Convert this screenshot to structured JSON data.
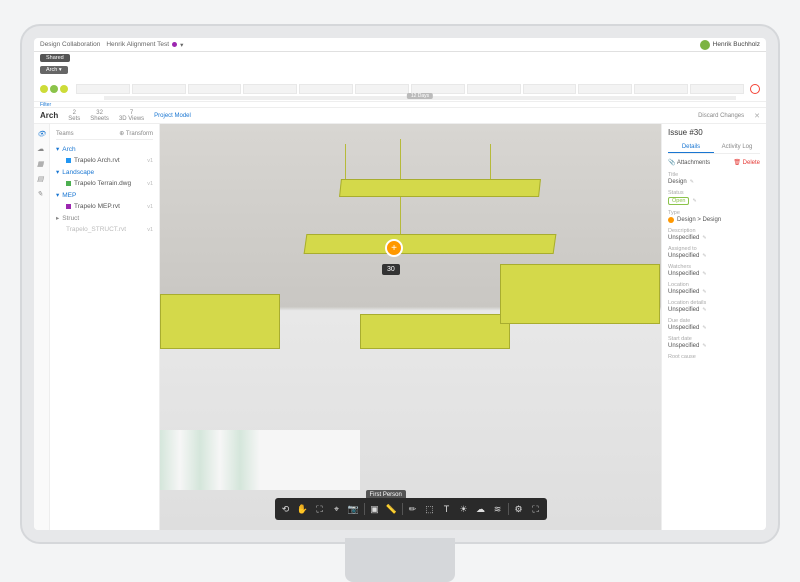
{
  "tabs": {
    "t1": "Design Collaboration",
    "t2": "Henrik Alignment Test",
    "user": "Henrik Buchholz"
  },
  "filters": {
    "shared": "Shared",
    "arch": "Arch",
    "filter": "Filter"
  },
  "timeline": {
    "label": "12 Days"
  },
  "meta": {
    "title": "Arch",
    "sets": "2",
    "sets_l": "Sets",
    "sheets": "32",
    "sheets_l": "Sheets",
    "views": "7",
    "views_l": "3D Views",
    "pm": "Project Model",
    "discard": "Discard Changes"
  },
  "tree": {
    "hdr1": "Teams",
    "hdr2": "Transform",
    "g1": "Arch",
    "i1": "Trapelo Arch.rvt",
    "g2": "Landscape",
    "i2": "Trapelo Terrain.dwg",
    "g3": "MEP",
    "i3": "Trapelo MEP.rvt",
    "g4": "Struct",
    "i4": "Trapelo_STRUCT.rvt"
  },
  "view": {
    "marker": "+",
    "tooltip": "30",
    "toolbar_tip": "First Person"
  },
  "panel": {
    "title": "Issue #30",
    "tab1": "Details",
    "tab2": "Activity Log",
    "attach": "Attachments",
    "delete": "Delete",
    "f_title": "Title",
    "v_title": "Design",
    "f_status": "Status",
    "v_status": "Open",
    "f_type": "Type",
    "v_type": "Design > Design",
    "f_desc": "Description",
    "v_desc": "Unspecified",
    "f_assign": "Assigned to",
    "v_assign": "Unspecified",
    "f_watch": "Watchers",
    "v_watch": "Unspecified",
    "f_loc": "Location",
    "v_loc": "Unspecified",
    "f_locd": "Location details",
    "v_locd": "Unspecified",
    "f_due": "Due date",
    "v_due": "Unspecified",
    "f_start": "Start date",
    "v_start": "Unspecified",
    "f_root": "Root cause"
  }
}
